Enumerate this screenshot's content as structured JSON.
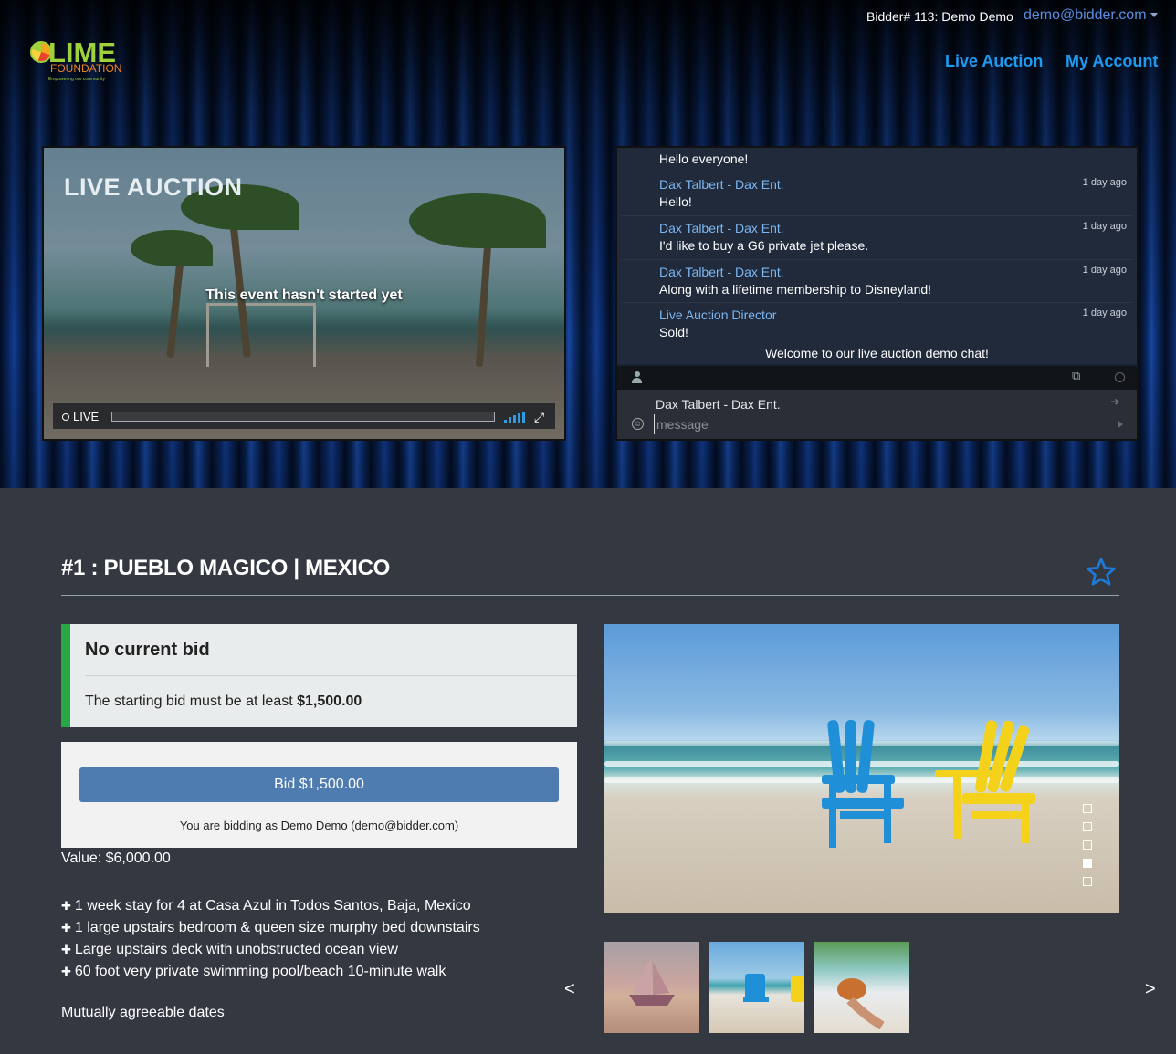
{
  "header": {
    "bidder_info": "Bidder# 113: Demo Demo",
    "email": "demo@bidder.com",
    "nav": {
      "live_auction": "Live Auction",
      "my_account": "My Account"
    }
  },
  "logo": {
    "name": "LIME",
    "subtitle": "FOUNDATION",
    "tagline": "Empowering our community"
  },
  "video": {
    "overlay_title": "LIVE AUCTION",
    "message": "This event hasn't started yet",
    "live_label": "LIVE"
  },
  "chat": {
    "first_message": "Hello everyone!",
    "messages": [
      {
        "author": "Dax Talbert - Dax Ent.",
        "time": "1 day ago",
        "text": "Hello!"
      },
      {
        "author": "Dax Talbert - Dax Ent.",
        "time": "1 day ago",
        "text": "I'd like to buy a G6 private jet please."
      },
      {
        "author": "Dax Talbert - Dax Ent.",
        "time": "1 day ago",
        "text": "Along with a lifetime membership to Disneyland!"
      },
      {
        "author": "Live Auction Director",
        "time": "1 day ago",
        "text": "Sold!"
      }
    ],
    "welcome": "Welcome to our live auction demo chat!",
    "current_user": "Dax Talbert - Dax Ent.",
    "input_placeholder": "message"
  },
  "lot": {
    "title": "#1 : PUEBLO MAGICO | MEXICO",
    "status_title": "No current bid",
    "starting_bid_text": "The starting bid must be at least ",
    "starting_bid_amount": "$1,500.00",
    "bid_button": "Bid $1,500.00",
    "bidding_as": "You are bidding as Demo Demo (demo@bidder.com)",
    "value": "Value: $6,000.00",
    "features": [
      "1 week stay for 4 at Casa Azul in Todos Santos, Baja, Mexico",
      "1 large upstairs bedroom & queen size  murphy bed downstairs",
      "Large upstairs deck with unobstructed ocean view",
      "60 foot very private swimming pool/beach 10-minute walk"
    ],
    "dates": "Mutually agreeable dates",
    "carousel": {
      "slide_count": 5,
      "active_slide": 4
    },
    "prev_arrow": "<",
    "next_arrow": ">"
  },
  "colors": {
    "link_blue": "#1d9bf0",
    "chat_author": "#7cb6f0",
    "status_green": "#28a745",
    "bid_button": "#4e7bb0",
    "page_bg": "#343841"
  },
  "icons": [
    "user-icon",
    "popout-icon",
    "status-icon",
    "smile-icon",
    "send-icon",
    "signout-icon",
    "star-icon",
    "signal-icon",
    "fullscreen-icon"
  ]
}
